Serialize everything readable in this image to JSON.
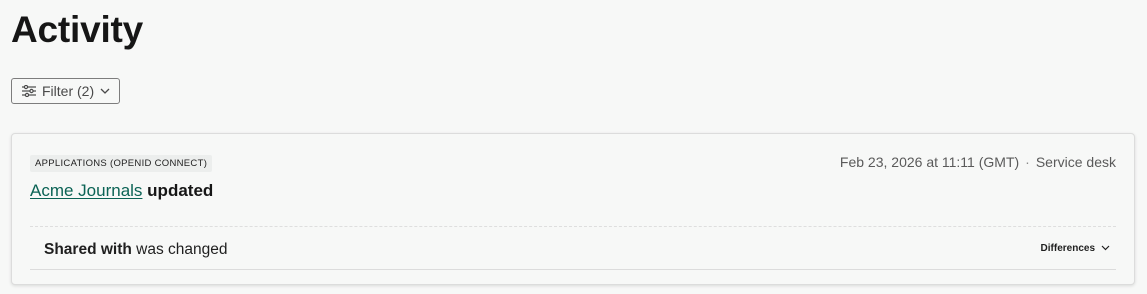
{
  "page": {
    "title": "Activity"
  },
  "toolbar": {
    "filter_label": "Filter (2)"
  },
  "activity": {
    "category": "APPLICATIONS (OPENID CONNECT)",
    "timestamp": "Feb 23, 2026 at 11:11 (GMT)",
    "separator": "·",
    "source": "Service desk",
    "subject_link": "Acme Journals",
    "verb": "updated",
    "change": {
      "field": "Shared with",
      "description": "was changed",
      "differences_label": "Differences"
    }
  },
  "colors": {
    "background": "#f7f8f7",
    "link": "#0b6355",
    "text": "#1f1f1f"
  },
  "icons": {
    "filter": "sliders-icon",
    "filter_chevron": "chevron-down-icon",
    "differences_chevron": "chevron-down-icon"
  }
}
